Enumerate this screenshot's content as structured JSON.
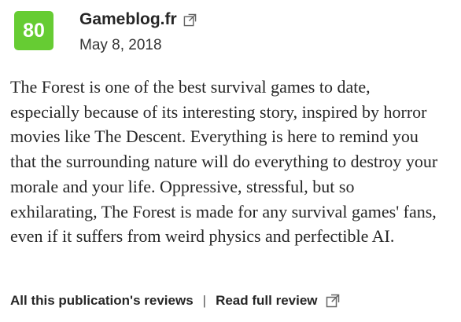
{
  "review": {
    "score": "80",
    "score_color": "#66cc33",
    "publication": "Gameblog.fr",
    "date": "May 8, 2018",
    "text": "The Forest is one of the best survival games to date, especially because of its interesting story, inspired by horror movies like The Descent. Everything is here to remind you that the surrounding nature will do everything to destroy your morale and your life. Oppressive, stressful, but so exhilarating, The Forest is made for any survival games' fans, even if it suffers from weird physics and perfectible AI."
  },
  "footer": {
    "all_reviews_label": "All this publication's reviews",
    "separator": "|",
    "read_full_label": "Read full review"
  },
  "icons": {
    "publication_external": "external-link-icon",
    "read_full_external": "external-link-icon"
  }
}
